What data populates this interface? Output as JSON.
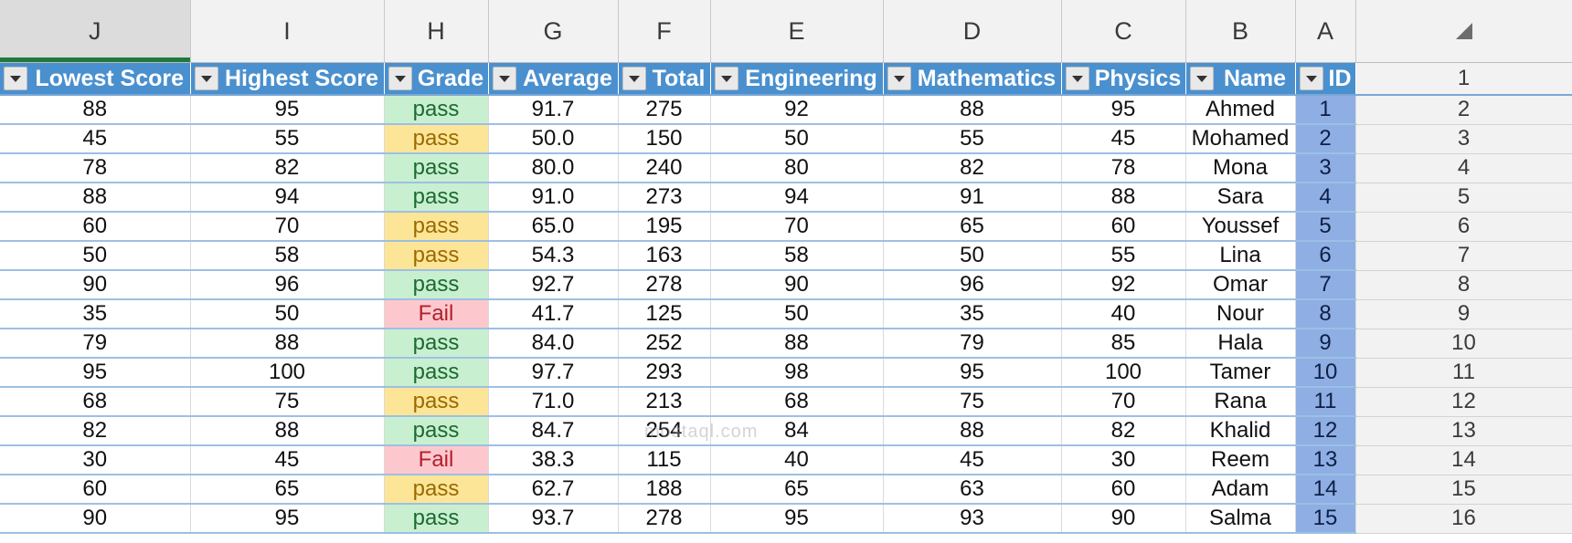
{
  "column_letters": [
    "J",
    "I",
    "H",
    "G",
    "F",
    "E",
    "D",
    "C",
    "B",
    "A"
  ],
  "headers": [
    "Lowest Score",
    "Highest Score",
    "Grade",
    "Average",
    "Total",
    "Engineering",
    "Mathematics",
    "Physics",
    "Name",
    "ID"
  ],
  "header_row_number": "1",
  "rows": [
    {
      "lowest": "88",
      "highest": "95",
      "grade": "pass",
      "grade_style": "green",
      "average": "91.7",
      "total": "275",
      "engineering": "92",
      "mathematics": "88",
      "physics": "95",
      "name": "Ahmed",
      "id": "1",
      "rownum": "2"
    },
    {
      "lowest": "45",
      "highest": "55",
      "grade": "pass",
      "grade_style": "yellow",
      "average": "50.0",
      "total": "150",
      "engineering": "50",
      "mathematics": "55",
      "physics": "45",
      "name": "Mohamed",
      "id": "2",
      "rownum": "3"
    },
    {
      "lowest": "78",
      "highest": "82",
      "grade": "pass",
      "grade_style": "green",
      "average": "80.0",
      "total": "240",
      "engineering": "80",
      "mathematics": "82",
      "physics": "78",
      "name": "Mona",
      "id": "3",
      "rownum": "4"
    },
    {
      "lowest": "88",
      "highest": "94",
      "grade": "pass",
      "grade_style": "green",
      "average": "91.0",
      "total": "273",
      "engineering": "94",
      "mathematics": "91",
      "physics": "88",
      "name": "Sara",
      "id": "4",
      "rownum": "5"
    },
    {
      "lowest": "60",
      "highest": "70",
      "grade": "pass",
      "grade_style": "yellow",
      "average": "65.0",
      "total": "195",
      "engineering": "70",
      "mathematics": "65",
      "physics": "60",
      "name": "Youssef",
      "id": "5",
      "rownum": "6"
    },
    {
      "lowest": "50",
      "highest": "58",
      "grade": "pass",
      "grade_style": "yellow",
      "average": "54.3",
      "total": "163",
      "engineering": "58",
      "mathematics": "50",
      "physics": "55",
      "name": "Lina",
      "id": "6",
      "rownum": "7"
    },
    {
      "lowest": "90",
      "highest": "96",
      "grade": "pass",
      "grade_style": "green",
      "average": "92.7",
      "total": "278",
      "engineering": "90",
      "mathematics": "96",
      "physics": "92",
      "name": "Omar",
      "id": "7",
      "rownum": "8"
    },
    {
      "lowest": "35",
      "highest": "50",
      "grade": "Fail",
      "grade_style": "red",
      "average": "41.7",
      "total": "125",
      "engineering": "50",
      "mathematics": "35",
      "physics": "40",
      "name": "Nour",
      "id": "8",
      "rownum": "9"
    },
    {
      "lowest": "79",
      "highest": "88",
      "grade": "pass",
      "grade_style": "green",
      "average": "84.0",
      "total": "252",
      "engineering": "88",
      "mathematics": "79",
      "physics": "85",
      "name": "Hala",
      "id": "9",
      "rownum": "10"
    },
    {
      "lowest": "95",
      "highest": "100",
      "grade": "pass",
      "grade_style": "green",
      "average": "97.7",
      "total": "293",
      "engineering": "98",
      "mathematics": "95",
      "physics": "100",
      "name": "Tamer",
      "id": "10",
      "rownum": "11"
    },
    {
      "lowest": "68",
      "highest": "75",
      "grade": "pass",
      "grade_style": "yellow",
      "average": "71.0",
      "total": "213",
      "engineering": "68",
      "mathematics": "75",
      "physics": "70",
      "name": "Rana",
      "id": "11",
      "rownum": "12"
    },
    {
      "lowest": "82",
      "highest": "88",
      "grade": "pass",
      "grade_style": "green",
      "average": "84.7",
      "total": "254",
      "engineering": "84",
      "mathematics": "88",
      "physics": "82",
      "name": "Khalid",
      "id": "12",
      "rownum": "13"
    },
    {
      "lowest": "30",
      "highest": "45",
      "grade": "Fail",
      "grade_style": "red",
      "average": "38.3",
      "total": "115",
      "engineering": "40",
      "mathematics": "45",
      "physics": "30",
      "name": "Reem",
      "id": "13",
      "rownum": "14"
    },
    {
      "lowest": "60",
      "highest": "65",
      "grade": "pass",
      "grade_style": "yellow",
      "average": "62.7",
      "total": "188",
      "engineering": "65",
      "mathematics": "63",
      "physics": "60",
      "name": "Adam",
      "id": "14",
      "rownum": "15"
    },
    {
      "lowest": "90",
      "highest": "95",
      "grade": "pass",
      "grade_style": "green",
      "average": "93.7",
      "total": "278",
      "engineering": "95",
      "mathematics": "93",
      "physics": "90",
      "name": "Salma",
      "id": "15",
      "rownum": "16"
    }
  ],
  "watermark": "mostaql.com",
  "colors": {
    "header_blue": "#4a90cf",
    "id_blue": "#8eaee4",
    "pass_green": "#c9efd1",
    "pass_yellow": "#fde597",
    "fail_red": "#fcc8cd"
  }
}
